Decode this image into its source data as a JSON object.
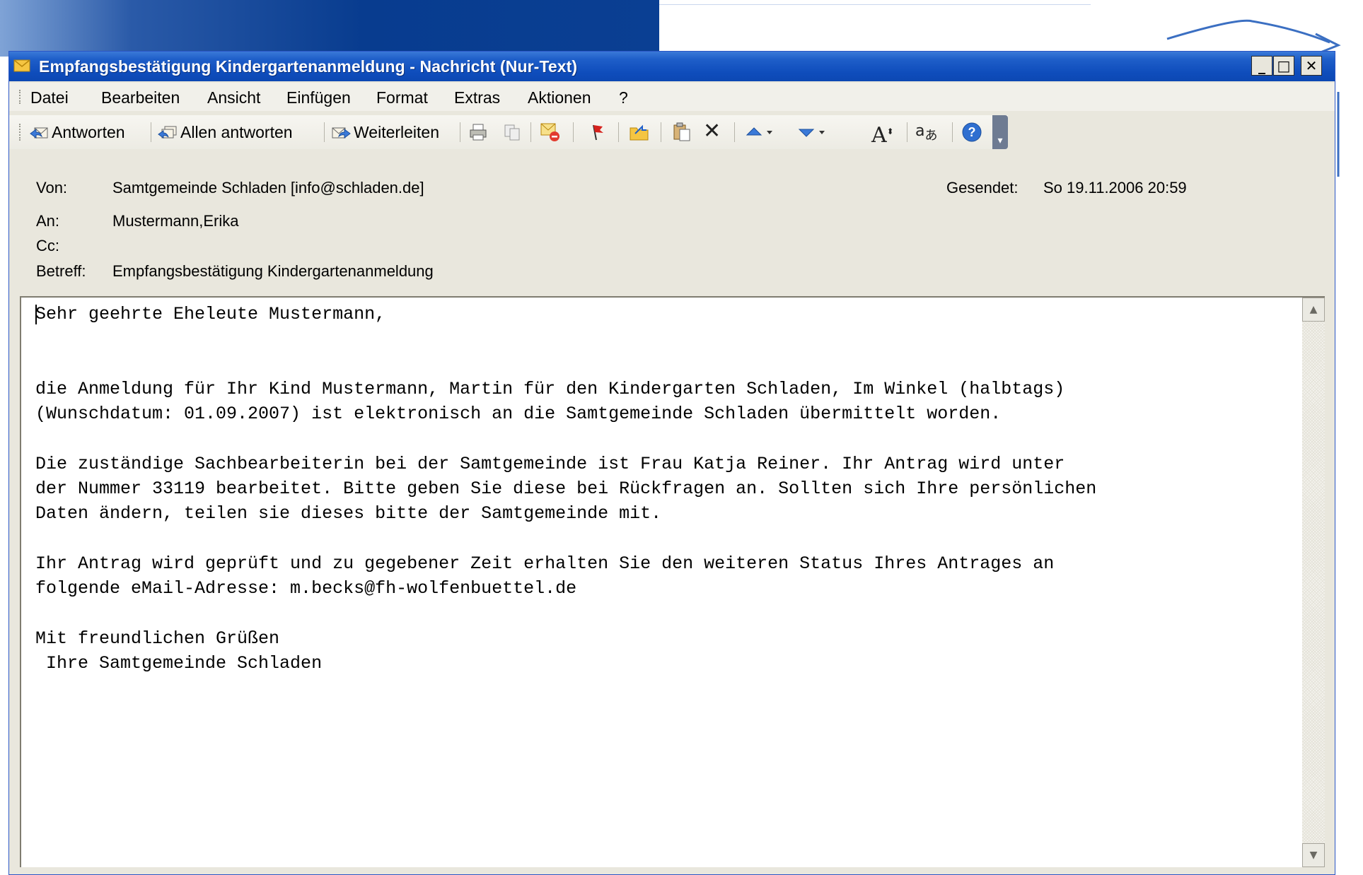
{
  "window": {
    "title": "Empfangsbestätigung Kindergartenanmeldung - Nachricht (Nur-Text)"
  },
  "menubar": {
    "items": [
      "Datei",
      "Bearbeiten",
      "Ansicht",
      "Einfügen",
      "Format",
      "Extras",
      "Aktionen",
      "?"
    ]
  },
  "toolbar": {
    "reply_label": "Antworten",
    "reply_all_label": "Allen antworten",
    "forward_label": "Weiterleiten",
    "icons": [
      "print-icon",
      "copy-icon",
      "mark-unread-icon",
      "flag-icon",
      "move-to-folder-icon",
      "paste-icon",
      "delete-icon",
      "previous-item-icon",
      "next-item-icon",
      "font-size-icon",
      "translate-icon",
      "help-icon"
    ]
  },
  "header": {
    "from_label": "Von:",
    "from_value": "Samtgemeinde Schladen [info@schladen.de]",
    "sent_label": "Gesendet:",
    "sent_value": "So 19.11.2006 20:59",
    "to_label": "An:",
    "to_value": "Mustermann,Erika",
    "cc_label": "Cc:",
    "cc_value": "",
    "subject_label": "Betreff:",
    "subject_value": "Empfangsbestätigung Kindergartenanmeldung"
  },
  "message": {
    "body": "Sehr geehrte Eheleute Mustermann,\n\n\ndie Anmeldung für Ihr Kind Mustermann, Martin für den Kindergarten Schladen, Im Winkel (halbtags)\n(Wunschdatum: 01.09.2007) ist elektronisch an die Samtgemeinde Schladen übermittelt worden.\n\nDie zuständige Sachbearbeiterin bei der Samtgemeinde ist Frau Katja Reiner. Ihr Antrag wird unter\nder Nummer 33119 bearbeitet. Bitte geben Sie diese bei Rückfragen an. Sollten sich Ihre persönlichen\nDaten ändern, teilen sie dieses bitte der Samtgemeinde mit.\n\nIhr Antrag wird geprüft und zu gegebener Zeit erhalten Sie den weiteren Status Ihres Antrages an\nfolgende eMail-Adresse: m.becks@fh-wolfenbuettel.de\n\nMit freundlichen Grüßen\n Ihre Samtgemeinde Schladen"
  },
  "colors": {
    "titlebar": "#0c48b3",
    "window_face": "#e9e7dd",
    "body_background": "#ffffff"
  }
}
